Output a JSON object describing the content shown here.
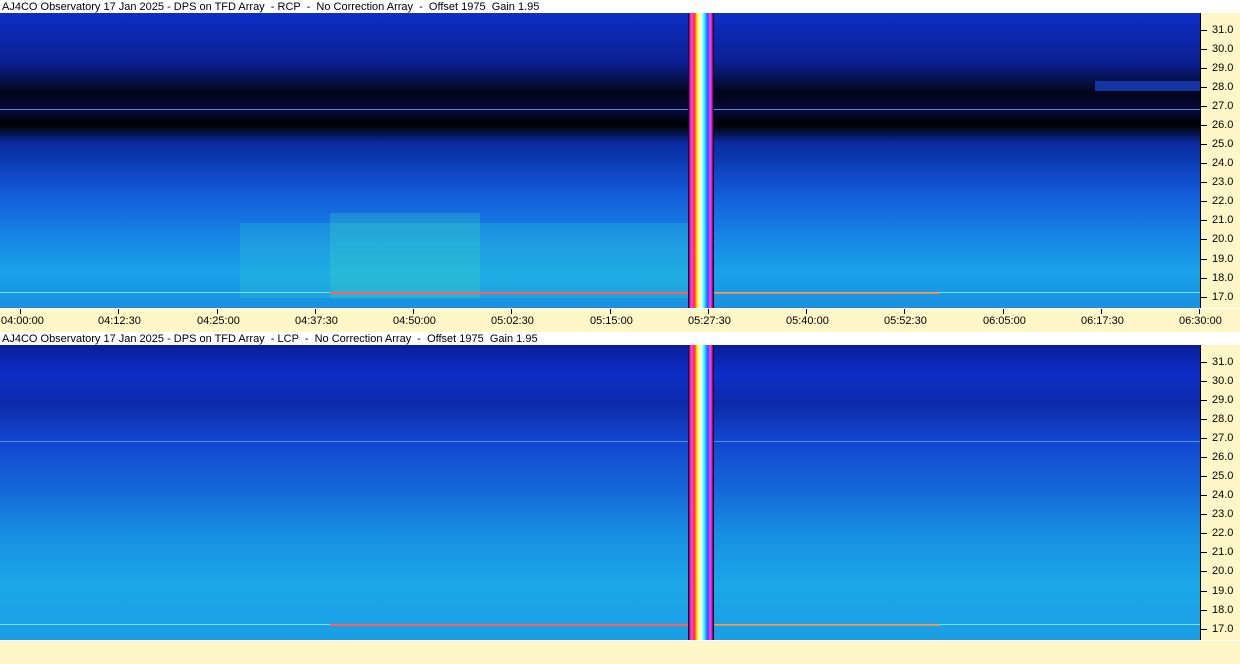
{
  "chart_data": [
    {
      "type": "heatmap",
      "title": "AJ4CO Observatory 17 Jan 2025 - DPS on TFD Array  - RCP  -  No Correction Array  -  Offset 1975  Gain 1.95",
      "x_ticks": [
        "04:00:00",
        "04:12:30",
        "04:25:00",
        "04:37:30",
        "04:50:00",
        "05:02:30",
        "05:15:00",
        "05:27:30",
        "05:40:00",
        "05:52:30",
        "06:05:00",
        "06:17:30",
        "06:30:00"
      ],
      "y_ticks": [
        "31.0",
        "30.0",
        "29.0",
        "28.0",
        "27.0",
        "26.0",
        "25.0",
        "24.0",
        "23.0",
        "22.0",
        "21.0",
        "20.0",
        "19.0",
        "18.0",
        "17.0"
      ],
      "ylim": [
        16.4,
        31.9
      ],
      "xlim": [
        "04:00:00",
        "06:30:00"
      ]
    },
    {
      "type": "heatmap",
      "title": "AJ4CO Observatory 17 Jan 2025 - DPS on TFD Array  - LCP  -  No Correction Array  -  Offset 1975  Gain 1.95",
      "x_ticks": [],
      "y_ticks": [
        "31.0",
        "30.0",
        "29.0",
        "28.0",
        "27.0",
        "26.0",
        "25.0",
        "24.0",
        "23.0",
        "22.0",
        "21.0",
        "20.0",
        "19.0",
        "18.0",
        "17.0"
      ],
      "ylim": [
        16.4,
        31.9
      ],
      "xlim": [
        "04:00:00",
        "06:30:00"
      ]
    }
  ]
}
